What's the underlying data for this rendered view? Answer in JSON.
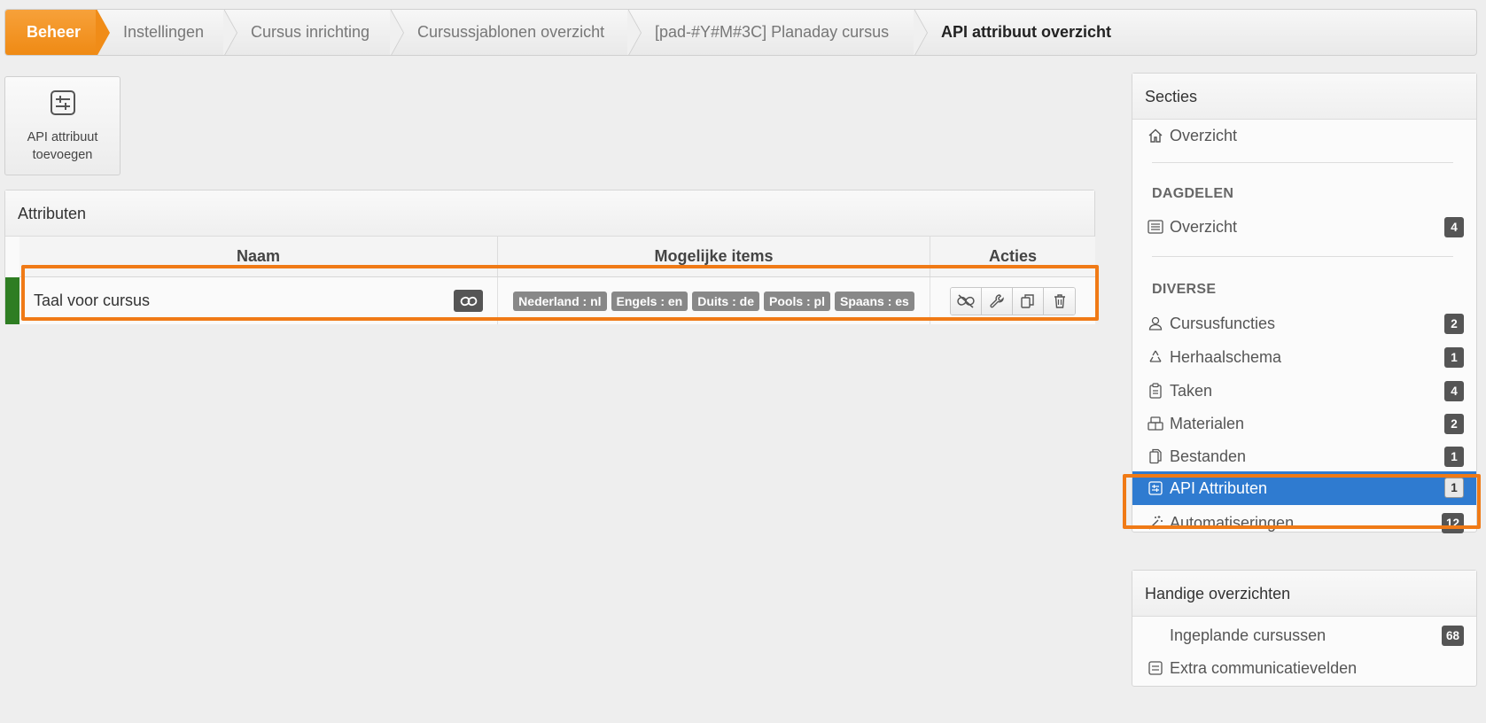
{
  "breadcrumb": [
    "Beheer",
    "Instellingen",
    "Cursus inrichting",
    "Cursussjablonen overzicht",
    "[pad-#Y#M#3C] Planaday cursus",
    "API attribuut overzicht"
  ],
  "add_button": {
    "line1": "API attribuut",
    "line2": "toevoegen"
  },
  "attributes_panel": {
    "title": "Attributen",
    "columns": [
      "Naam",
      "Mogelijke items",
      "Acties"
    ],
    "rows": [
      {
        "naam": "Taal voor cursus",
        "items": [
          "Nederland : nl",
          "Engels : en",
          "Duits : de",
          "Pools : pl",
          "Spaans : es"
        ],
        "marker_color": "#2e7d22"
      }
    ]
  },
  "sections_panel": {
    "title": "Secties",
    "overview": "Overzicht",
    "group_dagdelen": "DAGDELEN",
    "dagdelen_items": [
      {
        "label": "Overzicht",
        "count": "4"
      }
    ],
    "group_diverse": "DIVERSE",
    "diverse_items": [
      {
        "label": "Cursusfuncties",
        "count": "2"
      },
      {
        "label": "Herhaalschema",
        "count": "1"
      },
      {
        "label": "Taken",
        "count": "4"
      },
      {
        "label": "Materialen",
        "count": "2"
      },
      {
        "label": "Bestanden",
        "count": "1"
      },
      {
        "label": "API Attributen",
        "count": "1",
        "active": true
      },
      {
        "label": "Automatiseringen",
        "count": "12"
      }
    ]
  },
  "handy_panel": {
    "title": "Handige overzichten",
    "items": [
      {
        "label": "Ingeplande cursussen",
        "count": "68"
      },
      {
        "label": "Extra communicatievelden"
      }
    ]
  },
  "colors": {
    "accent_orange": "#f08c18",
    "active_blue": "#2f7bd0",
    "highlight": "#f07a16"
  }
}
